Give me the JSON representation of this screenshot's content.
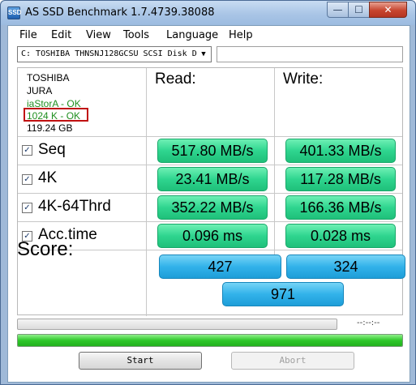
{
  "window": {
    "title": "AS SSD Benchmark 1.7.4739.38088",
    "controls": {
      "minimize": "—",
      "maximize": "☐",
      "close": "✕"
    }
  },
  "menu": {
    "items": [
      "File",
      "Edit",
      "View",
      "Tools",
      "Language",
      "Help"
    ]
  },
  "drive": {
    "selected": "C: TOSHIBA THNSNJ128GCSU SCSI Disk D",
    "arrow": "▼"
  },
  "drive_info": {
    "vendor": "TOSHIBA",
    "model": "JURA",
    "driver": "iaStorA - OK",
    "alignment": "1024 K - OK",
    "size": "119.24 GB"
  },
  "columns": {
    "read": "Read:",
    "write": "Write:"
  },
  "tests": [
    {
      "label": "Seq",
      "checked": "✓",
      "read": "517.80 MB/s",
      "write": "401.33 MB/s"
    },
    {
      "label": "4K",
      "checked": "✓",
      "read": "23.41 MB/s",
      "write": "117.28 MB/s"
    },
    {
      "label": "4K-64Thrd",
      "checked": "✓",
      "read": "352.22 MB/s",
      "write": "166.36 MB/s"
    },
    {
      "label": "Acc.time",
      "checked": "✓",
      "read": "0.096 ms",
      "write": "0.028 ms"
    }
  ],
  "score": {
    "label": "Score:",
    "read": "427",
    "write": "324",
    "total": "971"
  },
  "progress": {
    "time": "--:--:--",
    "overall_fraction": 1.0
  },
  "buttons": {
    "start": "Start",
    "abort": "Abort"
  },
  "colors": {
    "result_green": "#2fd58f",
    "score_blue": "#32b2ea",
    "alignment_highlight": "#c01010",
    "ok_text": "#1f8f1f"
  }
}
